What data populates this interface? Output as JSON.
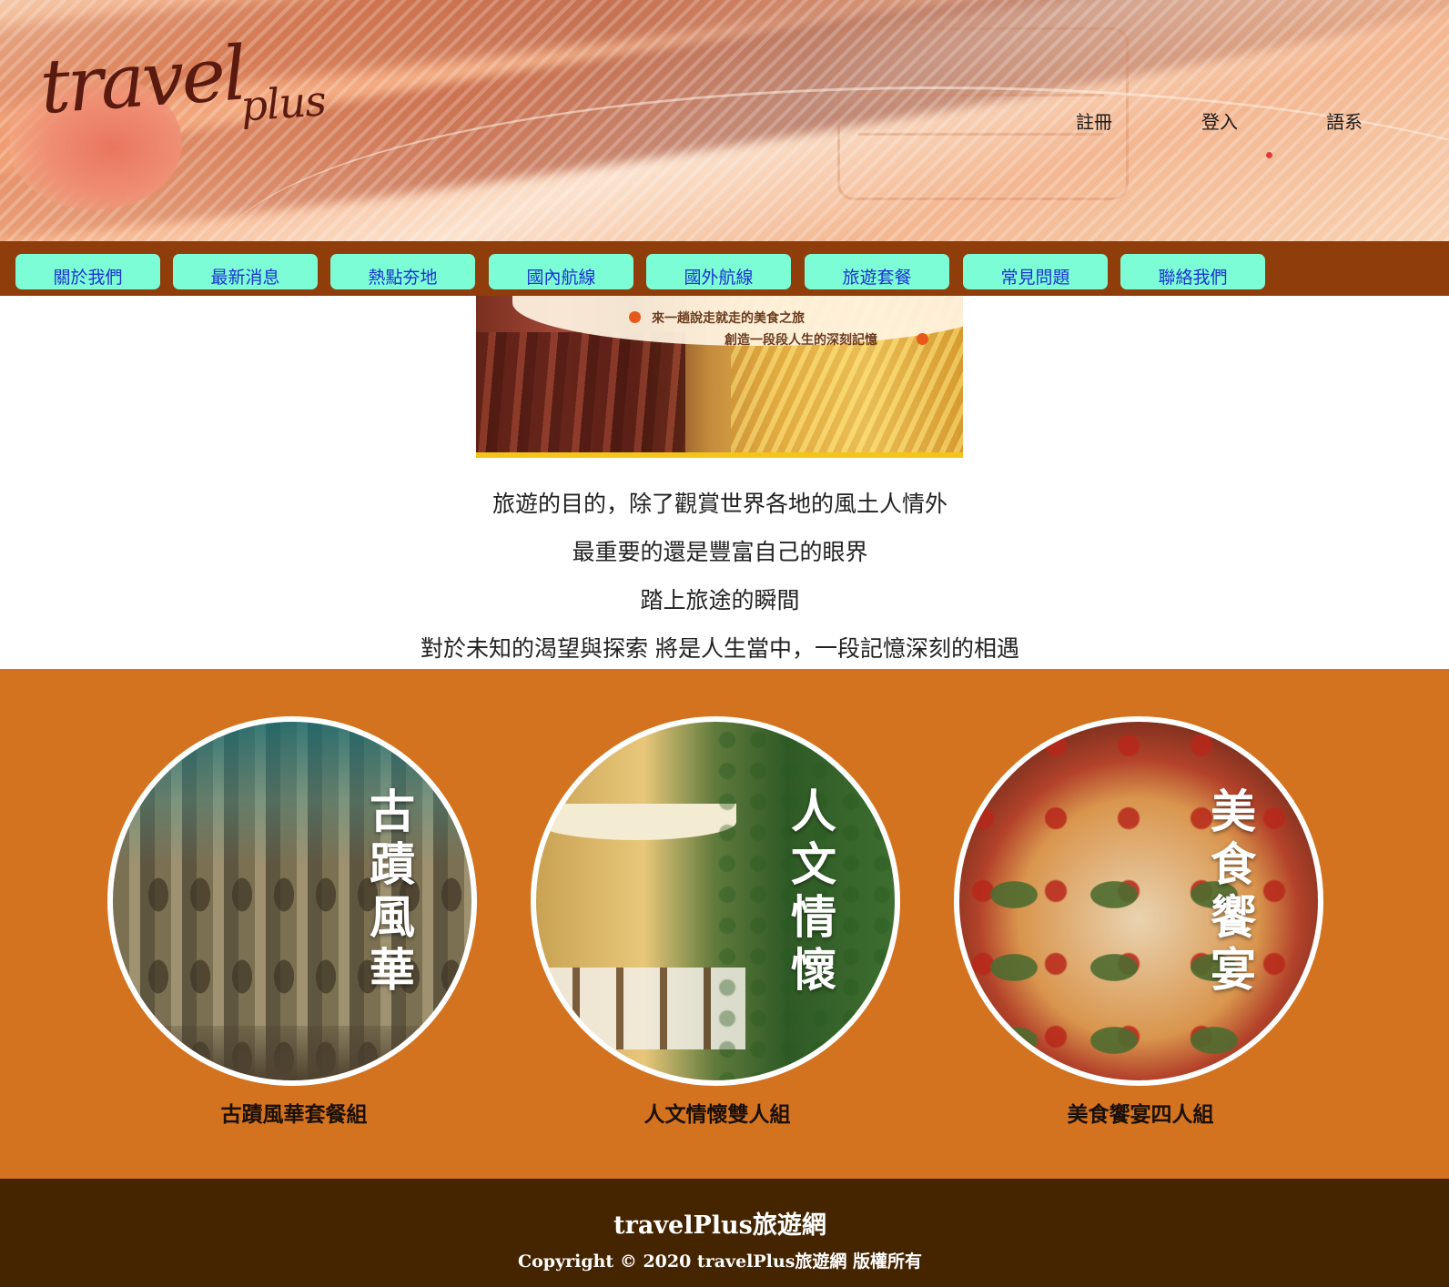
{
  "header": {
    "logo_main": "travel",
    "logo_sub": "plus",
    "links": [
      "註冊",
      "登入",
      "語系"
    ]
  },
  "nav": {
    "items": [
      "關於我們",
      "最新消息",
      "熱點夯地",
      "國內航線",
      "國外航線",
      "旅遊套餐",
      "常見問題",
      "聯絡我們"
    ]
  },
  "banner": {
    "line1": "來一趟說走就走的美食之旅",
    "line2": "創造一段段人生的深刻記憶"
  },
  "intro": {
    "lines": [
      "旅遊的目的，除了觀賞世界各地的風土人情外",
      "最重要的還是豐富自己的眼界",
      "踏上旅途的瞬間",
      "對於未知的渴望與探索 將是人生當中，一段記憶深刻的相遇"
    ]
  },
  "packages": [
    {
      "image_text": "古蹟風華",
      "title": "古蹟風華套餐組"
    },
    {
      "image_text": "人文情懷",
      "title": "人文情懷雙人組"
    },
    {
      "image_text": "美食饗宴",
      "title": "美食饗宴四人組"
    }
  ],
  "footer": {
    "brand": "travelPlus旅遊網",
    "copyright": "Copyright © 2020 travelPlus旅遊網 版權所有"
  },
  "colors": {
    "nav_bar": "#8e3d0b",
    "nav_button": "#7dfdd5",
    "nav_text": "#1c34d4",
    "section_bg": "#d4731f",
    "footer_bg": "#452400"
  }
}
